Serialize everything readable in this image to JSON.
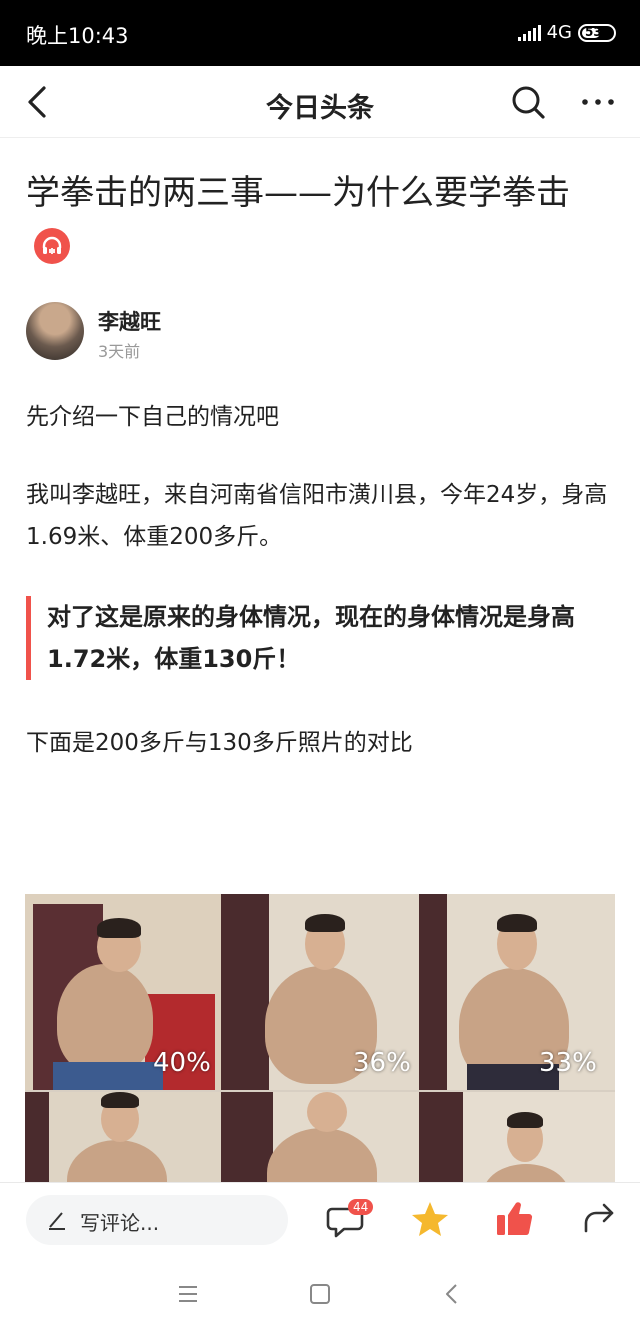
{
  "status_bar": {
    "time": "晚上10:43",
    "network": "4G",
    "battery": "53"
  },
  "top_bar": {
    "title": "今日头条",
    "icons": [
      "back-icon",
      "search-icon",
      "more-icon"
    ]
  },
  "article": {
    "title": "学拳击的两三事——为什么要学拳击",
    "author": {
      "name": "李越旺",
      "time": "3天前"
    },
    "paragraphs": [
      "先介绍一下自己的情况吧",
      "我叫李越旺，来自河南省信阳市潢川县，今年24岁，身高1.69米、体重200多斤。"
    ],
    "quote": "对了这是原来的身体情况，现在的身体情况是身高1.72米，体重130斤！",
    "paragraph_after_quote": "下面是200多斤与130多斤照片的对比",
    "photo": {
      "labels": [
        "40%",
        "36%",
        "33%"
      ]
    }
  },
  "bottom_bar": {
    "comment_placeholder": "写评论...",
    "comment_count": "44",
    "icons": [
      "pen-icon",
      "comment-icon",
      "favorite-star-icon",
      "like-thumb-icon",
      "share-icon"
    ],
    "colors": {
      "star": "#f5b82e",
      "like": "#f0524b"
    }
  },
  "nav_bar": {
    "icons": [
      "menu-icon",
      "home-icon",
      "back-nav-icon"
    ]
  },
  "colors": {
    "accent": "#f0524b"
  }
}
